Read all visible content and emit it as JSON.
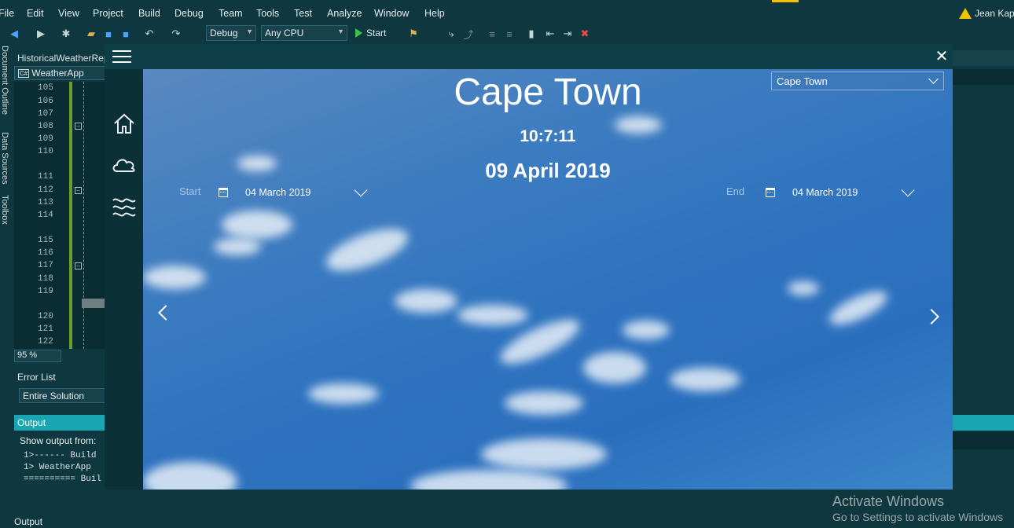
{
  "ide": {
    "menu": [
      "File",
      "Edit",
      "View",
      "Project",
      "Build",
      "Debug",
      "Team",
      "Tools",
      "Test",
      "Analyze",
      "Window",
      "Help"
    ],
    "user_name": "Jean Kapu",
    "toolbar": {
      "config": "Debug",
      "platform": "Any CPU",
      "start_label": "Start"
    },
    "side_tabs": [
      "Document Outline",
      "Data Sources",
      "Toolbox"
    ],
    "doc_tab": "HistoricalWeatherRep",
    "file_name": "WeatherApp",
    "line_numbers": [
      "105",
      "106",
      "107",
      "108",
      "109",
      "110",
      "111",
      "112",
      "113",
      "114",
      "115",
      "116",
      "117",
      "118",
      "119",
      "120",
      "121",
      "122"
    ],
    "zoom": "95 %",
    "error_list_title": "Error List",
    "error_scope": "Entire Solution",
    "output_title": "Output",
    "show_output_from": "Show output from:",
    "output_lines": [
      "1>------ Build",
      "1>  WeatherApp",
      "========== Buil"
    ],
    "bottom_tab": "Output",
    "activate_title": "Activate Windows",
    "activate_sub": "Go to Settings to activate Windows"
  },
  "app": {
    "close_glyph": "✕",
    "city": "Cape Town",
    "time": "10:7:11",
    "date": "09 April 2019",
    "city_dropdown_value": "Cape Town",
    "start_label": "Start",
    "start_date": "04 March 2019",
    "end_label": "End",
    "end_date": "04 March 2019",
    "nav_icons": [
      "home-icon",
      "cloud-icon",
      "waves-icon"
    ]
  }
}
